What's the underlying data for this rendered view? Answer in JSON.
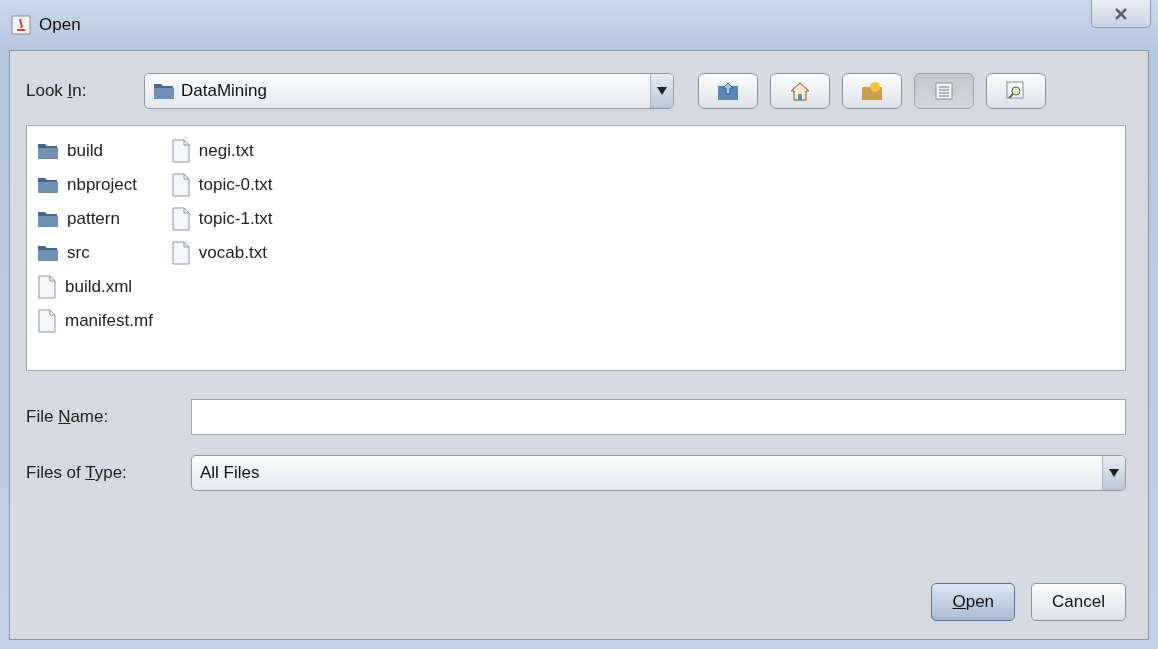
{
  "window": {
    "title": "Open"
  },
  "look_in": {
    "label": {
      "pre": "Look ",
      "key": "I",
      "post": "n:"
    },
    "value": "DataMining"
  },
  "toolbar": [
    {
      "kind": "up",
      "selected": false
    },
    {
      "kind": "home",
      "selected": false
    },
    {
      "kind": "new-folder",
      "selected": false
    },
    {
      "kind": "list",
      "selected": true
    },
    {
      "kind": "details",
      "selected": false
    }
  ],
  "files": [
    {
      "name": "build",
      "kind": "folder"
    },
    {
      "name": "nbproject",
      "kind": "folder"
    },
    {
      "name": "pattern",
      "kind": "folder"
    },
    {
      "name": "src",
      "kind": "folder"
    },
    {
      "name": "build.xml",
      "kind": "file"
    },
    {
      "name": "manifest.mf",
      "kind": "file"
    },
    {
      "name": "negi.txt",
      "kind": "file"
    },
    {
      "name": "topic-0.txt",
      "kind": "file"
    },
    {
      "name": "topic-1.txt",
      "kind": "file"
    },
    {
      "name": "vocab.txt",
      "kind": "file"
    }
  ],
  "file_name": {
    "label": {
      "pre": "File ",
      "key": "N",
      "post": "ame:"
    }
  },
  "files_of_type": {
    "label": {
      "pre": "Files of ",
      "key": "T",
      "post": "ype:"
    },
    "value": "All Files"
  },
  "buttons": [
    {
      "label": {
        "key": "O",
        "post": "pen"
      },
      "default": true
    },
    {
      "label": {
        "pre": "Cancel"
      },
      "default": false
    }
  ]
}
